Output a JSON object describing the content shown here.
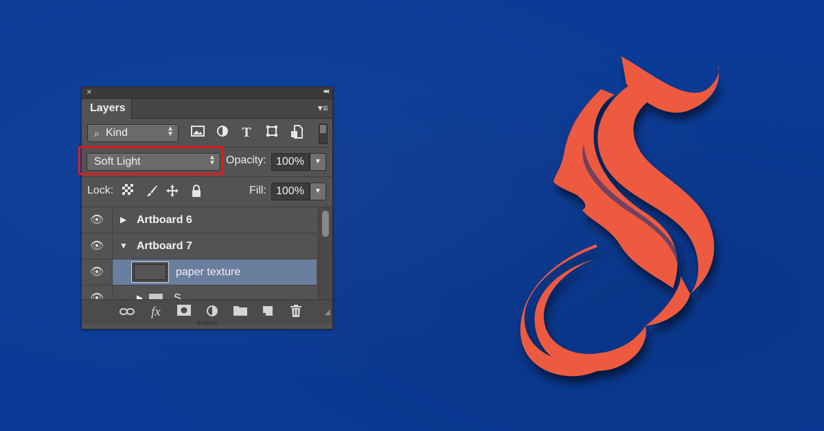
{
  "colors": {
    "background": "#0a3b96",
    "ribbon": "#ee5a40",
    "panel": "#535353",
    "selected_row": "#6a7e9e",
    "highlight": "#e21b1b"
  },
  "panel": {
    "close_icon": "×",
    "collapse_icon": "◂◂",
    "tab_label": "Layers",
    "menu_icon": "▾≡",
    "filter": {
      "kind_label": "Kind",
      "search_icon": "⌕",
      "icons": [
        "image-filter-icon",
        "adjustment-filter-icon",
        "type-filter-icon",
        "shape-filter-icon",
        "smart-object-filter-icon"
      ]
    },
    "blend_mode": "Soft Light",
    "opacity_label": "Opacity:",
    "opacity_value": "100%",
    "lock_label": "Lock:",
    "fill_label": "Fill:",
    "fill_value": "100%",
    "layers": [
      {
        "name": "Artboard 6",
        "expanded": false,
        "visible": true
      },
      {
        "name": "Artboard 7",
        "expanded": true,
        "visible": true
      },
      {
        "name": "paper texture",
        "selected": true,
        "visible": true
      },
      {
        "name": "S",
        "type": "group",
        "visible": true
      }
    ],
    "footer_icons": [
      "link-layers-icon",
      "fx-icon",
      "layer-mask-icon",
      "adjustment-layer-icon",
      "new-group-icon",
      "new-layer-icon",
      "delete-icon"
    ],
    "fx_label": "fx"
  }
}
